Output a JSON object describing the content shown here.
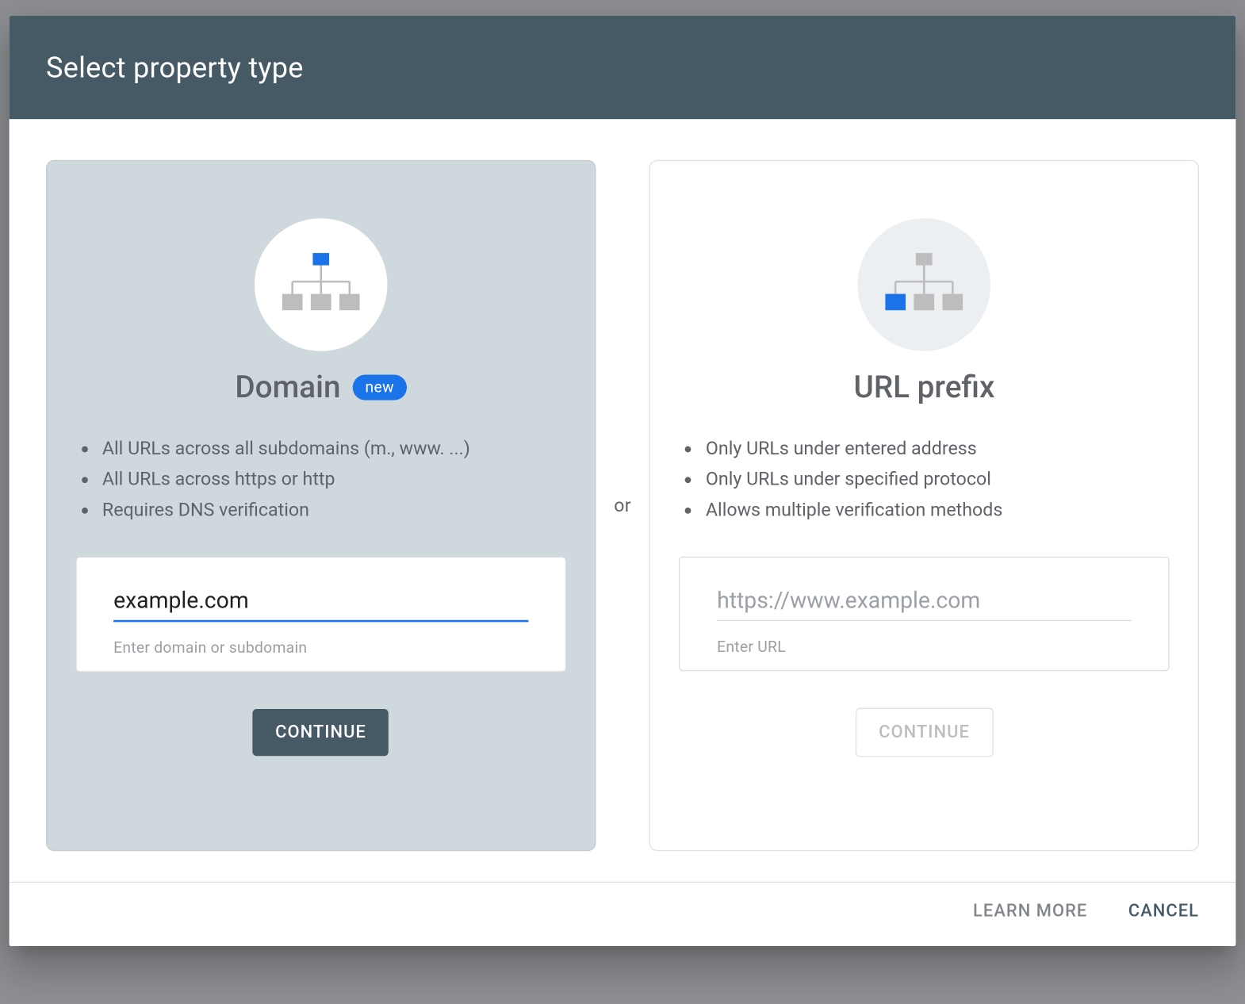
{
  "dialog": {
    "title": "Select property type",
    "divider": "or"
  },
  "domain_card": {
    "title": "Domain",
    "badge": "new",
    "features": [
      "All URLs across all subdomains (m., www. ...)",
      "All URLs across https or http",
      "Requires DNS verification"
    ],
    "input_value": "example.com",
    "input_helper": "Enter domain or subdomain",
    "continue_label": "CONTINUE"
  },
  "url_card": {
    "title": "URL prefix",
    "features": [
      "Only URLs under entered address",
      "Only URLs under specified protocol",
      "Allows multiple verification methods"
    ],
    "input_placeholder": "https://www.example.com",
    "input_helper": "Enter URL",
    "continue_label": "CONTINUE"
  },
  "footer": {
    "learn_more": "LEARN MORE",
    "cancel": "CANCEL"
  }
}
